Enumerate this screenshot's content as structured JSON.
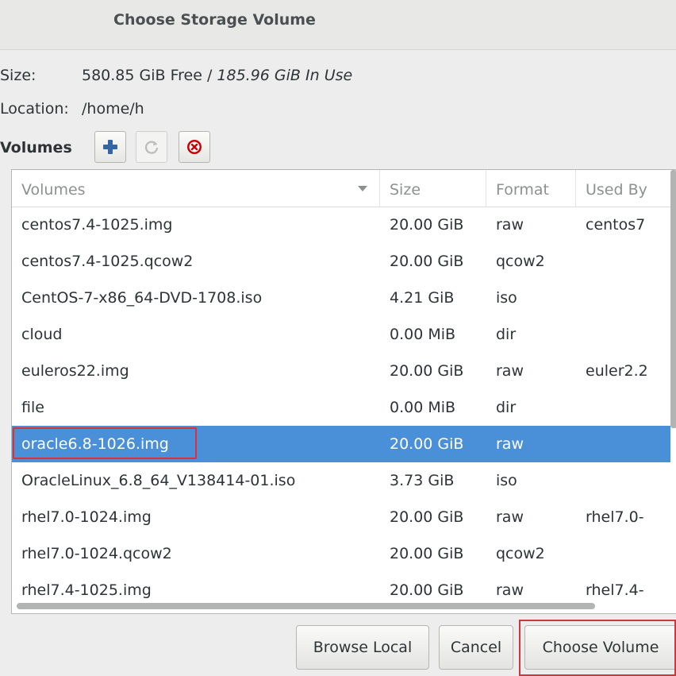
{
  "window": {
    "title": "Choose Storage Volume"
  },
  "pool_info": {
    "size_label": "Size:",
    "size_free": "580.85 GiB Free",
    "size_sep": " / ",
    "size_used": "185.96 GiB In Use",
    "location_label": "Location:",
    "location_value": "/home/h",
    "volumes_label": "Volumes"
  },
  "toolbar": {
    "add_icon": "plus-icon",
    "refresh_icon": "refresh-icon",
    "delete_icon": "delete-icon"
  },
  "columns": [
    "Volumes",
    "Size",
    "Format",
    "Used By"
  ],
  "rows": [
    {
      "name": "centos7.4-1025.img",
      "size": "20.00 GiB",
      "format": "raw",
      "used_by": "centos7"
    },
    {
      "name": "centos7.4-1025.qcow2",
      "size": "20.00 GiB",
      "format": "qcow2",
      "used_by": ""
    },
    {
      "name": "CentOS-7-x86_64-DVD-1708.iso",
      "size": "4.21 GiB",
      "format": "iso",
      "used_by": ""
    },
    {
      "name": "cloud",
      "size": "0.00 MiB",
      "format": "dir",
      "used_by": ""
    },
    {
      "name": "euleros22.img",
      "size": "20.00 GiB",
      "format": "raw",
      "used_by": "euler2.2"
    },
    {
      "name": "file",
      "size": "0.00 MiB",
      "format": "dir",
      "used_by": ""
    },
    {
      "name": "oracle6.8-1026.img",
      "size": "20.00 GiB",
      "format": "raw",
      "used_by": ""
    },
    {
      "name": "OracleLinux_6.8_64_V138414-01.iso",
      "size": "3.73 GiB",
      "format": "iso",
      "used_by": ""
    },
    {
      "name": "rhel7.0-1024.img",
      "size": "20.00 GiB",
      "format": "raw",
      "used_by": "rhel7.0-"
    },
    {
      "name": "rhel7.0-1024.qcow2",
      "size": "20.00 GiB",
      "format": "qcow2",
      "used_by": ""
    },
    {
      "name": "rhel7.4-1025.img",
      "size": "20.00 GiB",
      "format": "raw",
      "used_by": "rhel7.4-"
    }
  ],
  "selected_row": "oracle6.8-1026.img",
  "buttons": {
    "browse_local": "Browse Local",
    "cancel": "Cancel",
    "choose_volume": "Choose Volume"
  },
  "colors": {
    "selection": "#4a90d9",
    "highlight_outline": "#d6333b",
    "add_icon": "#3465a4",
    "delete_icon": "#cc0000"
  }
}
